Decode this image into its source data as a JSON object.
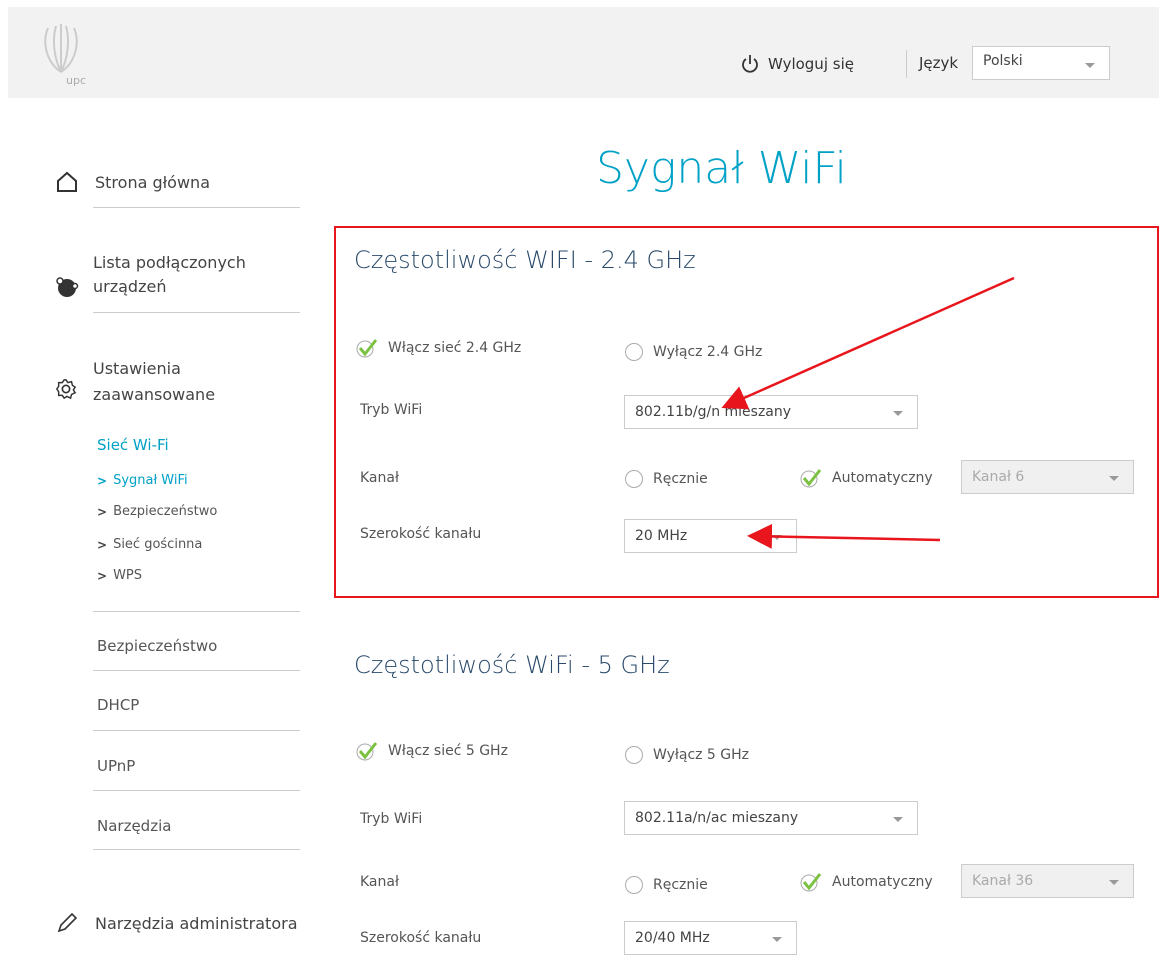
{
  "header": {
    "logo_text": "upc",
    "logout_label": "Wyloguj się",
    "language_label": "Język",
    "language_value": "Polski"
  },
  "sidebar": {
    "home": "Strona główna",
    "devices_line1": "Lista podłączonych",
    "devices_line2": "urządzeń",
    "advanced_line1": "Ustawienia",
    "advanced_line2": "zaawansowane",
    "wifi_heading": "Sieć Wi-Fi",
    "wifi_items": [
      "Sygnał WiFi",
      "Bezpieczeństwo",
      "Sieć gościnna",
      "WPS"
    ],
    "security": "Bezpieczeństwo",
    "dhcp": "DHCP",
    "upnp": "UPnP",
    "tools": "Narzędzia",
    "admin_tools": "Narzędzia administratora"
  },
  "page_title": "Sygnał WiFi",
  "band24": {
    "title": "Częstotliwość WIFI - 2.4 GHz",
    "enable_label": "Włącz sieć 2.4 GHz",
    "disable_label": "Wyłącz 2.4 GHz",
    "mode_label": "Tryb WiFi",
    "mode_value": "802.11b/g/n mieszany",
    "channel_label": "Kanał",
    "manual_label": "Ręcznie",
    "auto_label": "Automatyczny",
    "channel_value": "Kanał 6",
    "width_label": "Szerokość kanału",
    "width_value": "20 MHz"
  },
  "band5": {
    "title": "Częstotliwość WiFi - 5 GHz",
    "enable_label": "Włącz sieć 5 GHz",
    "disable_label": "Wyłącz 5 GHz",
    "mode_label": "Tryb WiFi",
    "mode_value": "802.11a/n/ac mieszany",
    "channel_label": "Kanał",
    "manual_label": "Ręcznie",
    "auto_label": "Automatyczny",
    "channel_value": "Kanał 36",
    "width_label": "Szerokość kanału",
    "width_value": "20/40 MHz"
  },
  "colors": {
    "accent": "#00a1c6",
    "check": "#7cc242",
    "annotation": "#e8161c"
  }
}
